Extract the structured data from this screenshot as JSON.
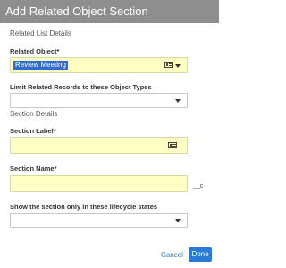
{
  "dialog": {
    "title": "Add Related Object Section"
  },
  "sections": {
    "related_list_details": "Related List Details",
    "section_details": "Section Details"
  },
  "fields": {
    "related_object": {
      "label": "Related Object*",
      "value": "Review Meeting"
    },
    "limit_types": {
      "label": "Limit Related Records to these Object Types",
      "value": ""
    },
    "section_label": {
      "label": "Section Label*",
      "value": ""
    },
    "section_name": {
      "label": "Section Name*",
      "value": "",
      "suffix": "__c"
    },
    "lifecycle_states": {
      "label": "Show the section only in these lifecycle states",
      "value": ""
    }
  },
  "footer": {
    "cancel_label": "Cancel",
    "done_label": "Done"
  },
  "colors": {
    "header_bg": "#8e8e8e",
    "required_bg": "#ffffc4",
    "selection_bg": "#2f6cd1",
    "link": "#2a79c4",
    "primary_button": "#2a7bd6"
  },
  "icons": [
    "lookup-icon",
    "chevron-down-icon"
  ]
}
